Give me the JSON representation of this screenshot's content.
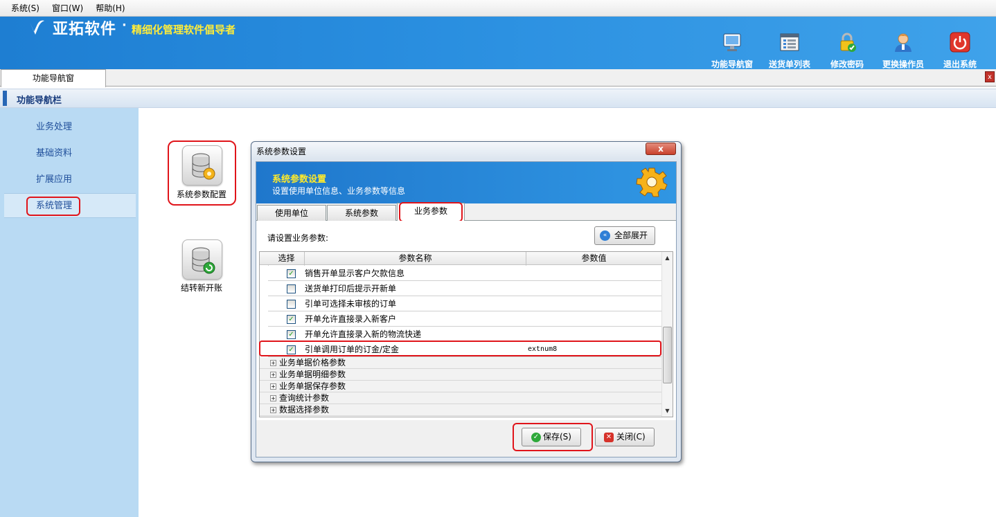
{
  "menubar": {
    "items": [
      "系统(S)",
      "窗口(W)",
      "帮助(H)"
    ]
  },
  "header": {
    "brand": "亚拓软件",
    "brand_dot": "·",
    "slogan": "精细化管理软件倡导者",
    "tools": [
      {
        "label": "功能导航窗",
        "icon": "monitor-icon"
      },
      {
        "label": "送货单列表",
        "icon": "list-icon"
      },
      {
        "label": "修改密码",
        "icon": "lock-icon"
      },
      {
        "label": "更换操作员",
        "icon": "user-icon"
      },
      {
        "label": "退出系统",
        "icon": "power-icon"
      }
    ]
  },
  "tabs": {
    "active": "功能导航窗",
    "close": "x"
  },
  "navbar": {
    "title": "功能导航栏"
  },
  "sidebar": {
    "items": [
      {
        "label": "业务处理"
      },
      {
        "label": "基础资料"
      },
      {
        "label": "扩展应用"
      },
      {
        "label": "系统管理"
      }
    ]
  },
  "content": {
    "icons": [
      {
        "label": "系统参数配置",
        "icon": "database-gear-icon"
      },
      {
        "label": "结转新开账",
        "icon": "database-refresh-icon"
      }
    ]
  },
  "dialog": {
    "title": "系统参数设置",
    "close": "x",
    "banner_title": "系统参数设置",
    "banner_subtitle": "设置使用单位信息、业务参数等信息",
    "tabs": [
      "使用单位",
      "系统参数",
      "业务参数"
    ],
    "active_tab": "业务参数",
    "prompt": "请设置业务参数:",
    "expand_button": "全部展开",
    "grid": {
      "headers": [
        "选择",
        "参数名称",
        "参数值"
      ],
      "rows": [
        {
          "checked": true,
          "name": "销售开单显示客户欠款信息",
          "value": ""
        },
        {
          "checked": false,
          "name": "送货单打印后提示开新单",
          "value": ""
        },
        {
          "checked": false,
          "name": "引单可选择未审核的订单",
          "value": ""
        },
        {
          "checked": true,
          "name": "开单允许直接录入新客户",
          "value": ""
        },
        {
          "checked": true,
          "name": "开单允许直接录入新的物流快递",
          "value": ""
        },
        {
          "checked": true,
          "name": "引单调用订单的订金/定金",
          "value": "extnum8"
        }
      ],
      "groups": [
        "业务单据价格参数",
        "业务单据明细参数",
        "业务单据保存参数",
        "查询统计参数",
        "数据选择参数"
      ]
    },
    "save_button": "保存(S)",
    "close_button": "关闭(C)",
    "check_mark": "✓",
    "expander_mark": "+"
  }
}
